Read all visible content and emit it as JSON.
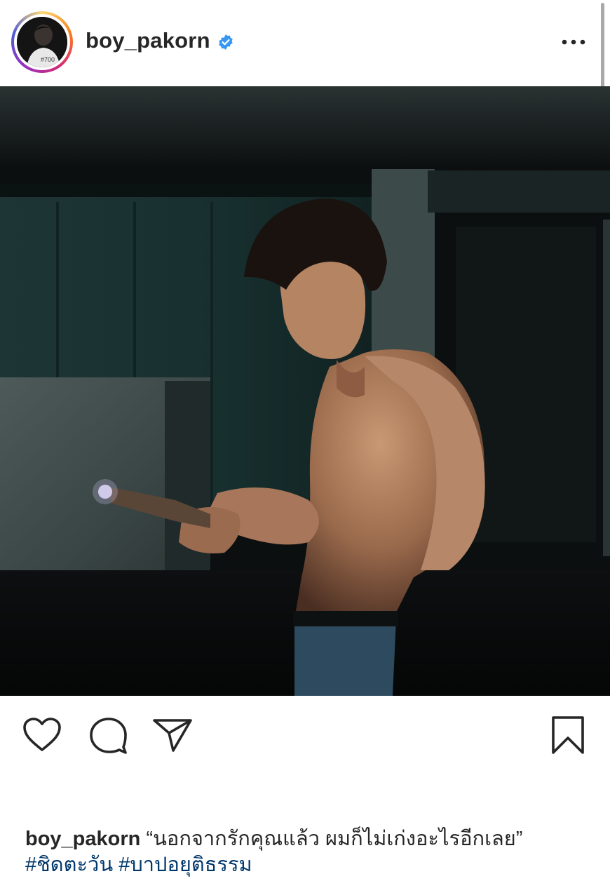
{
  "post": {
    "username": "boy_pakorn",
    "verified": true,
    "more_icon": "more-horizontal-icon",
    "photo_description_icon": "post-photo"
  },
  "actions": {
    "like_icon": "heart-icon",
    "comment_icon": "comment-icon",
    "share_icon": "send-icon",
    "save_icon": "bookmark-icon"
  },
  "caption": {
    "username": "boy_pakorn",
    "text": "“นอกจากรักคุณแล้ว ผมก็ไม่เก่งอะไรอีกเลย”",
    "hashtags": [
      "#ชิดตะวัน",
      "#บาปอยุติธรรม"
    ]
  },
  "colors": {
    "text": "#262626",
    "hashtag": "#00376b",
    "verified": "#3897f0"
  }
}
